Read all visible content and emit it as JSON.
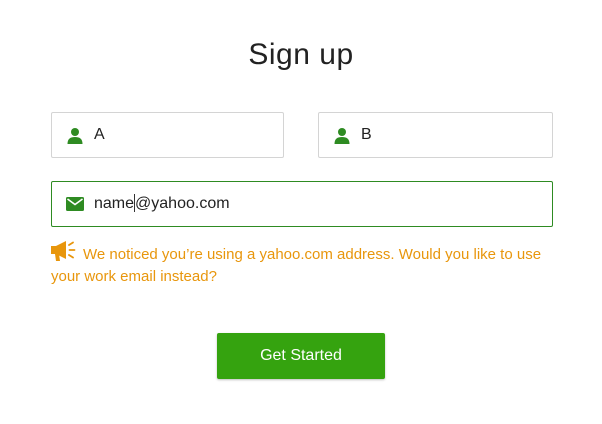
{
  "header": {
    "title": "Sign up"
  },
  "form": {
    "first_name": {
      "value": "A",
      "icon": "user-icon"
    },
    "last_name": {
      "value": "B",
      "icon": "user-icon"
    },
    "email": {
      "value_before_caret": "name",
      "value_after_caret": "@yahoo.com",
      "icon": "envelope-icon"
    },
    "notice": {
      "icon": "megaphone-icon",
      "text": "We noticed you’re using a yahoo.com address. Would you like to use your work email instead?"
    },
    "submit_label": "Get Started"
  },
  "colors": {
    "accent_green": "#35a30f",
    "icon_green": "#2e8b22",
    "warning_orange": "#e8960c",
    "text_dark": "#222222"
  }
}
